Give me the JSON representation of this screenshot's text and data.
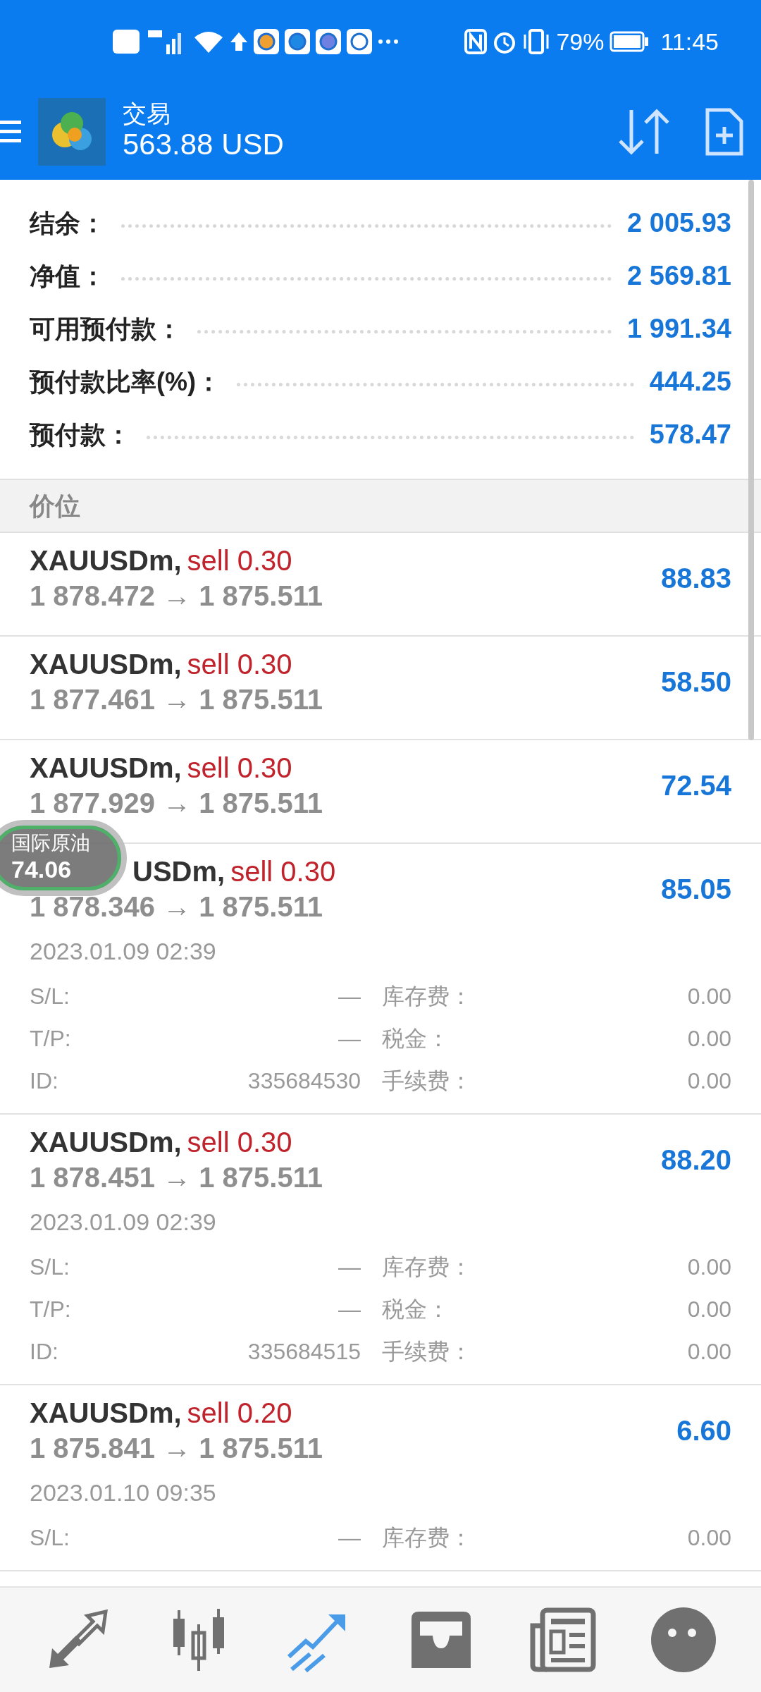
{
  "status_bar": {
    "battery": "79%",
    "time": "11:45"
  },
  "header": {
    "title": "交易",
    "balance": "563.88 USD"
  },
  "summary": [
    {
      "label": "结余：",
      "value": "2 005.93"
    },
    {
      "label": "净值：",
      "value": "2 569.81"
    },
    {
      "label": "可用预付款：",
      "value": "1 991.34"
    },
    {
      "label": "预付款比率(%)：",
      "value": "444.25"
    },
    {
      "label": "预付款：",
      "value": "578.47"
    }
  ],
  "section_title": "价位",
  "positions": [
    {
      "symbol": "XAUUSDm,",
      "side": "sell 0.30",
      "prices": "1 878.472 → 1 875.511",
      "profit": "88.83"
    },
    {
      "symbol": "XAUUSDm,",
      "side": "sell 0.30",
      "prices": "1 877.461 → 1 875.511",
      "profit": "58.50"
    },
    {
      "symbol": "XAUUSDm,",
      "side": "sell 0.30",
      "prices": "1 877.929 → 1 875.511",
      "profit": "72.54"
    },
    {
      "overlay": {
        "name": "国际原油",
        "price": "74.06"
      },
      "symbol": "USDm,",
      "side": "sell 0.30",
      "prices": "1 878.346 → 1 875.511",
      "profit": "85.05",
      "date": "2023.01.09 02:39",
      "details": [
        {
          "label": "S/L:",
          "value": "—",
          "label_2": "库存费：",
          "value_2": "0.00"
        },
        {
          "label": "T/P:",
          "value": "—",
          "label_2": "税金：",
          "value_2": "0.00"
        },
        {
          "label": "ID:",
          "value": "335684530",
          "label_2": "手续费：",
          "value_2": "0.00"
        }
      ]
    },
    {
      "symbol": "XAUUSDm,",
      "side": "sell 0.30",
      "prices": "1 878.451 → 1 875.511",
      "profit": "88.20",
      "date": "2023.01.09 02:39",
      "details": [
        {
          "label": "S/L:",
          "value": "—",
          "label_2": "库存费：",
          "value_2": "0.00"
        },
        {
          "label": "T/P:",
          "value": "—",
          "label_2": "税金：",
          "value_2": "0.00"
        },
        {
          "label": "ID:",
          "value": "335684515",
          "label_2": "手续费：",
          "value_2": "0.00"
        }
      ]
    },
    {
      "symbol": "XAUUSDm,",
      "side": "sell 0.20",
      "prices": "1 875.841 → 1 875.511",
      "profit": "6.60",
      "date": "2023.01.10 09:35",
      "details": [
        {
          "label": "S/L:",
          "value": "—",
          "label_2": "库存费：",
          "value_2": "0.00"
        }
      ]
    }
  ],
  "bottom_nav": [
    {
      "selected": false
    },
    {
      "selected": false
    },
    {
      "selected": true
    },
    {
      "selected": false
    },
    {
      "selected": false
    },
    {
      "selected": false
    }
  ]
}
